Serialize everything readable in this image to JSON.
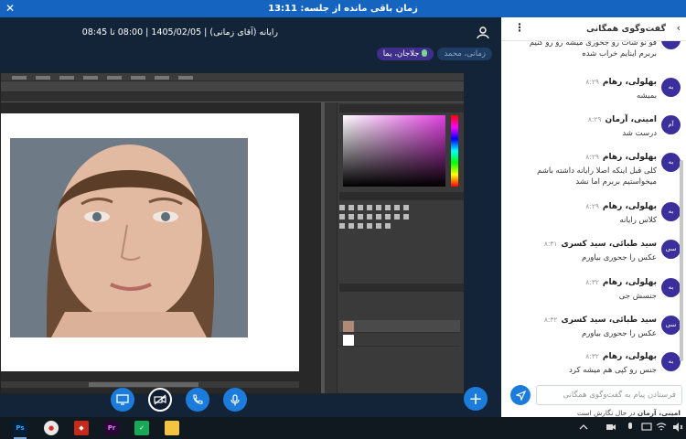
{
  "top_banner": {
    "title": "زمان باقی مانده از جلسه: 13:11",
    "close_glyph": "✕"
  },
  "session": {
    "info": "رایانه (آقای زمانی) | 1405/02/05 | 08:00 تا 08:45",
    "presenters": [
      {
        "label": "زمانی، محمد",
        "state": "muted"
      },
      {
        "label": "جلاجان، یما",
        "state": "active"
      }
    ]
  },
  "controls": {
    "screen_share": "screen-share",
    "camera": "camera-off",
    "phone": "phone",
    "mic": "microphone",
    "add": "+"
  },
  "chat": {
    "title": "گفت‌وگوی همگانی",
    "back_glyph": "‹",
    "more_glyph": "⋮",
    "messages": [
      {
        "avatar": "",
        "name": "",
        "time": "",
        "text": "فو نو شات رو جحوری میشه رو رو کنیم بربرم اینایم خراب شده",
        "partial": true
      },
      {
        "avatar": "به",
        "name": "بهلولی، رهام",
        "time": "۸:۲۹",
        "text": "بمیشه"
      },
      {
        "avatar": "آم",
        "name": "امینی، آرمان",
        "time": "۸:۲۹",
        "text": "درست شد"
      },
      {
        "avatar": "به",
        "name": "بهلولی، رهام",
        "time": "۸:۲۹",
        "text": "کلی قبل اینکه اصلا رایانه داشته باشم میخواستیم بربرم اما نشد"
      },
      {
        "avatar": "به",
        "name": "بهلولی، رهام",
        "time": "۸:۲۹",
        "text": "کلاس رایانه"
      },
      {
        "avatar": "سی",
        "name": "سید طبائی، سید کسری",
        "time": "۸:۳۱",
        "text": "عکس را جحوری بیاورم"
      },
      {
        "avatar": "به",
        "name": "بهلولی، رهام",
        "time": "۸:۳۲",
        "text": "جنسش جی"
      },
      {
        "avatar": "سی",
        "name": "سید طبائی، سید کسری",
        "time": "۸:۳۲",
        "text": "عکس را جحوری بیاورم"
      },
      {
        "avatar": "به",
        "name": "بهلولی، رهام",
        "time": "۸:۳۲",
        "text": "جنس رو کپی هم میشه کرد"
      }
    ],
    "composer_placeholder": "فرستادن پیام به گفت‌وگوی همگانی",
    "typing_name": "امینی، آرمان",
    "typing_text": "در حال نگارش است"
  },
  "taskbar": {
    "apps": [
      {
        "name": "photoshop",
        "label": "Ps",
        "color": "#001e36",
        "fg": "#31a8ff"
      },
      {
        "name": "record",
        "label": "●",
        "color": "#e8e8e8",
        "fg": "#d93025"
      },
      {
        "name": "presentation",
        "label": "◆",
        "color": "#c42b1c",
        "fg": "#ffffff"
      },
      {
        "name": "premiere",
        "label": "Pr",
        "color": "#2a0634",
        "fg": "#e77cff"
      },
      {
        "name": "shield",
        "label": "✓",
        "color": "#18a957",
        "fg": "#ffffff"
      },
      {
        "name": "folder",
        "label": "",
        "color": "#f3c443",
        "fg": "#f3c443"
      }
    ]
  },
  "colors": {
    "accent": "#1b7cdb",
    "banner": "#1565c0",
    "avatar": "#3b2f9b"
  }
}
